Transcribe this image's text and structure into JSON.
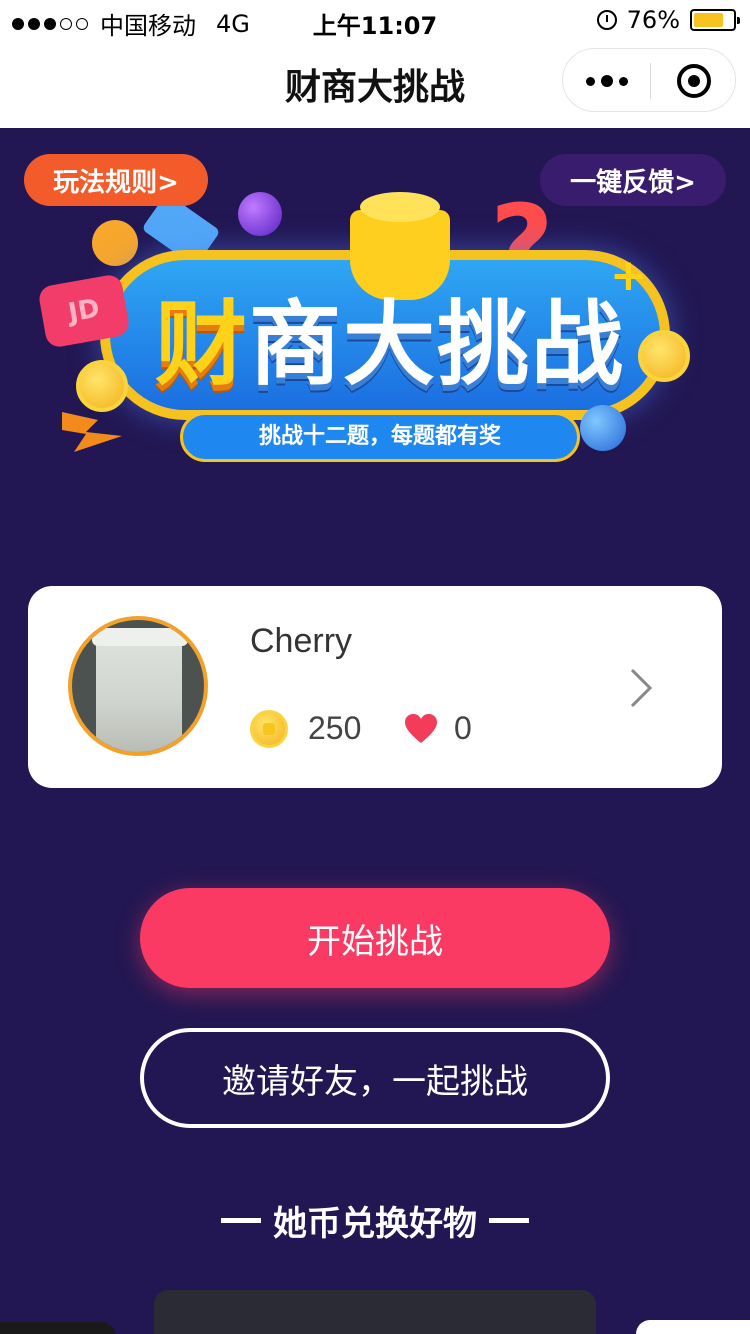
{
  "status_bar": {
    "carrier": "中国移动",
    "network": "4G",
    "time": "上午11:07",
    "battery": "76%",
    "battery_level": 0.76,
    "signal_bars": 3,
    "signal_total": 5
  },
  "nav": {
    "title": "财商大挑战"
  },
  "banner": {
    "rules_label": "玩法规则>",
    "feedback_label": "一键反馈>",
    "title_first_char": "财",
    "title_rest": "商大挑战",
    "subtitle": "挑战十二题，每题都有奖",
    "jd_badge": "JD"
  },
  "profile": {
    "username": "Cherry",
    "coins": "250",
    "likes": "0"
  },
  "actions": {
    "start_label": "开始挑战",
    "invite_label": "邀请好友，一起挑战"
  },
  "section": {
    "title": "她币兑换好物"
  },
  "colors": {
    "background": "#221752",
    "primary_button": "#fb3a63",
    "rules_button": "#f35b2b",
    "feedback_button": "#3a1c6e",
    "avatar_border": "#f2a12b",
    "coin": "#f4b11b",
    "heart": "#f23c5a"
  }
}
